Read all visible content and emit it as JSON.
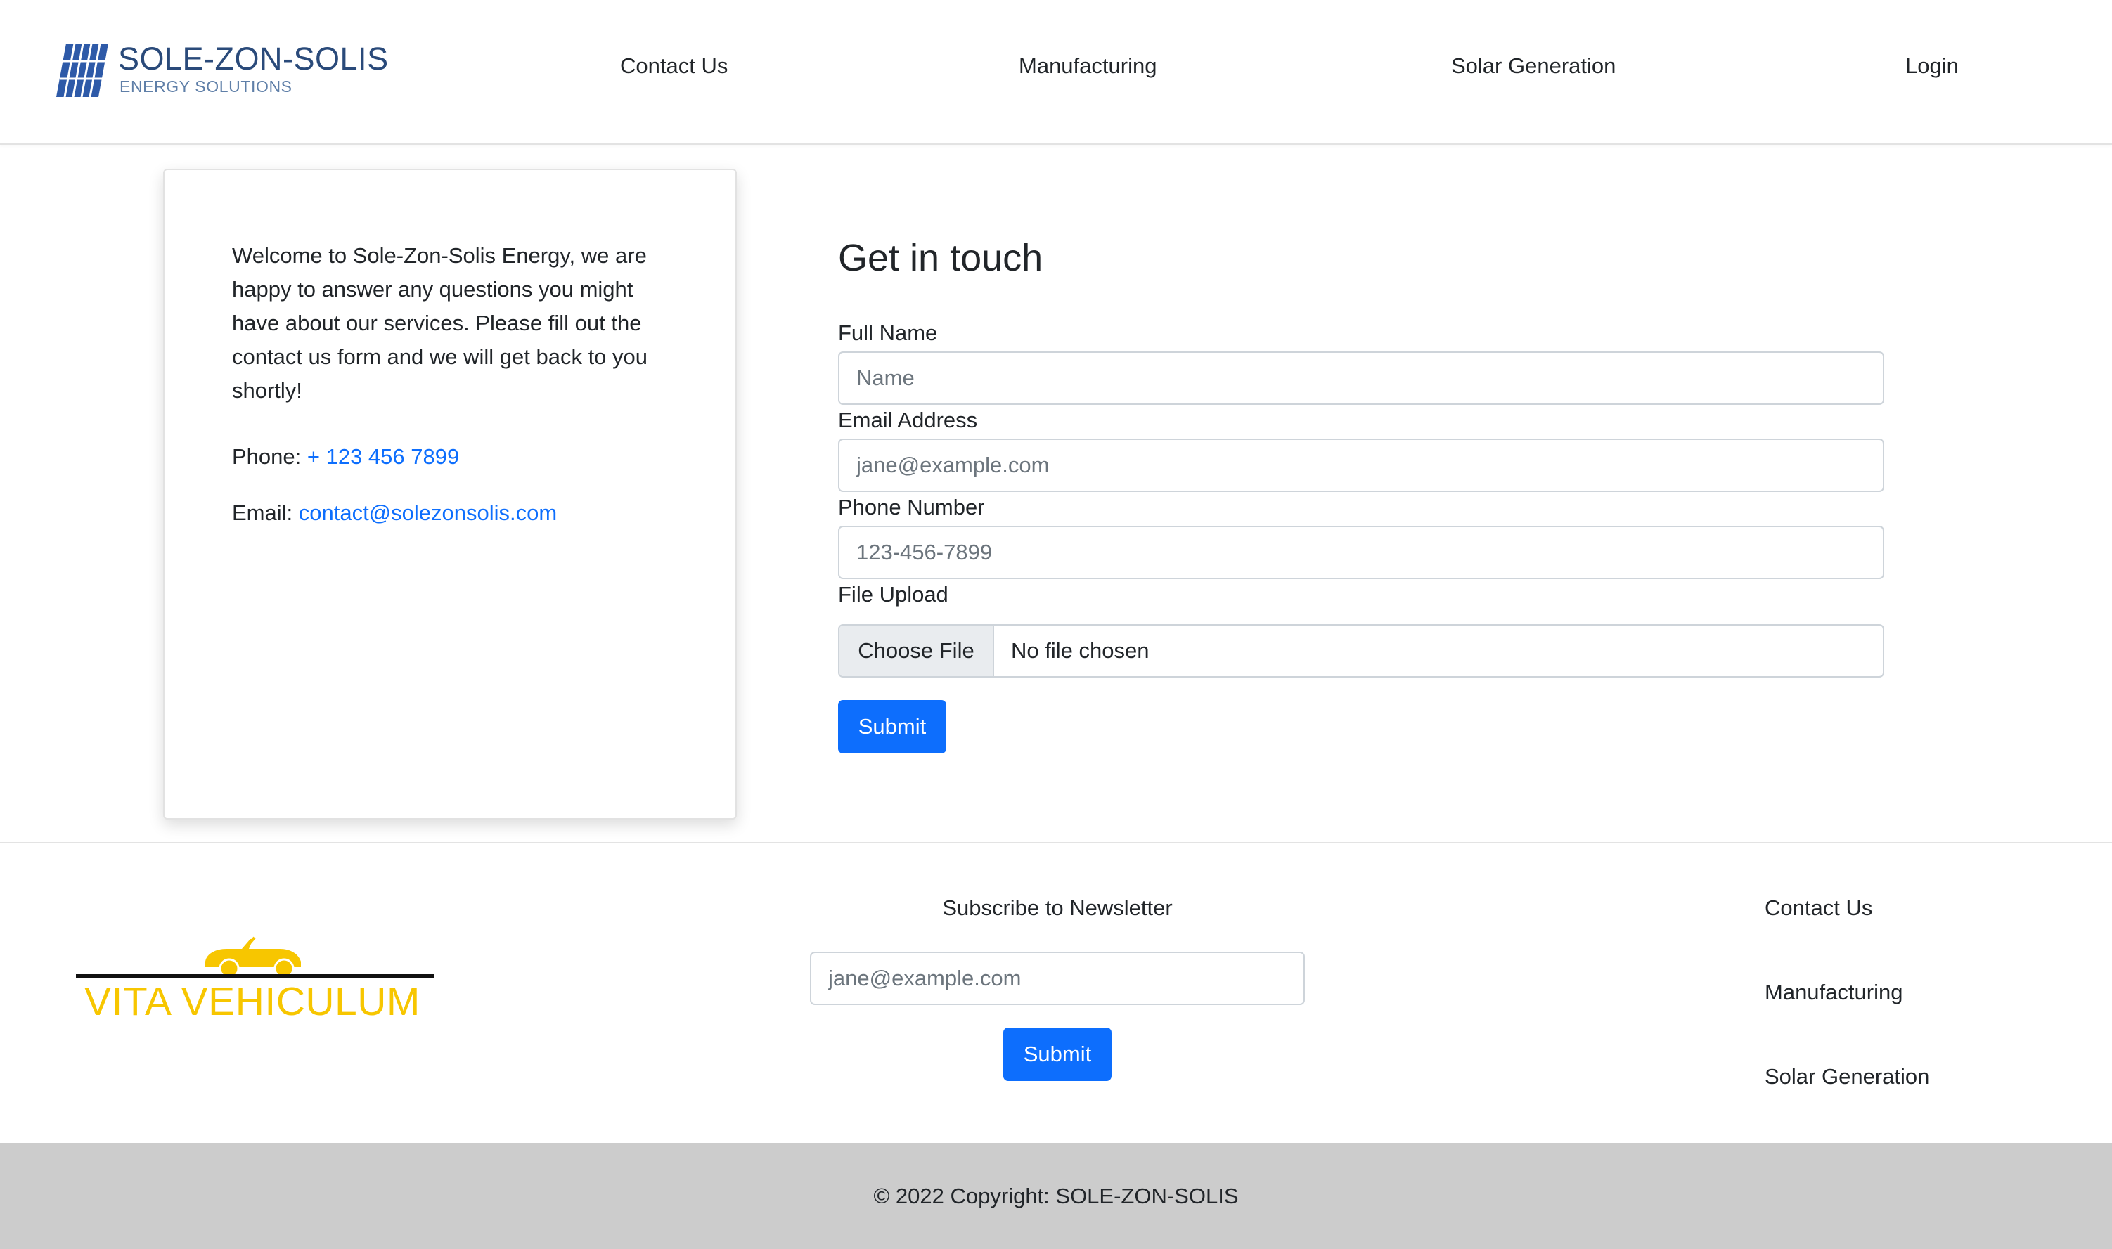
{
  "brand": {
    "name": "SOLE-ZON-SOLIS",
    "tagline": "ENERGY SOLUTIONS",
    "icon": "solar-panel-icon"
  },
  "nav": {
    "contact": "Contact Us",
    "manufacturing": "Manufacturing",
    "solar": "Solar Generation",
    "login": "Login"
  },
  "info": {
    "welcome": "Welcome to Sole-Zon-Solis Energy, we are happy to answer any questions you might have about our services. Please fill out the contact us form and we will get back to you shortly!",
    "phone_label": "Phone:",
    "phone_value": "+ 123 456 7899",
    "email_label": "Email:",
    "email_value": "contact@solezonsolis.com"
  },
  "form": {
    "title": "Get in touch",
    "name_label": "Full Name",
    "name_placeholder": "Name",
    "email_label": "Email Address",
    "email_placeholder": "jane@example.com",
    "phone_label": "Phone Number",
    "phone_placeholder": "123-456-7899",
    "file_label": "File Upload",
    "file_button": "Choose File",
    "file_status": "No file chosen",
    "submit": "Submit"
  },
  "footer": {
    "partner_logo_text": "VITA VEHICULUM",
    "newsletter_title": "Subscribe to Newsletter",
    "newsletter_placeholder": "jane@example.com",
    "newsletter_submit": "Submit",
    "links": {
      "contact": "Contact Us",
      "manufacturing": "Manufacturing",
      "solar": "Solar Generation"
    },
    "copyright": "© 2022 Copyright: SOLE-ZON-SOLIS"
  },
  "colors": {
    "primary": "#0d6efd",
    "brand_blue": "#2a4a7a",
    "partner_yellow": "#f7c600",
    "copyright_bg": "#cccccc"
  }
}
